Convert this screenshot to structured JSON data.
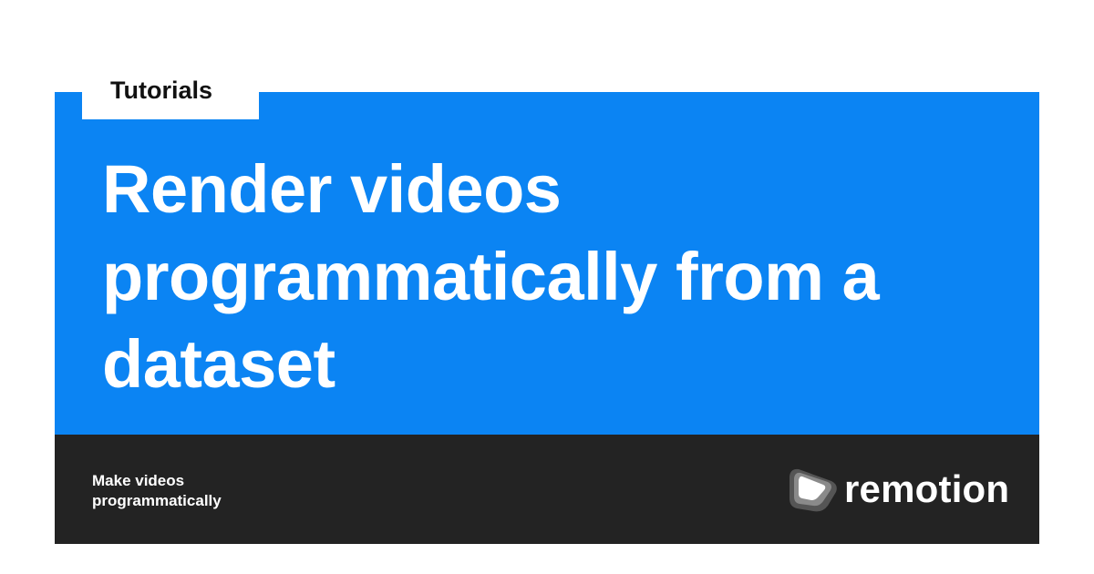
{
  "category": {
    "label": "Tutorials"
  },
  "headline": {
    "text": "Render videos programmatically from a dataset"
  },
  "footer": {
    "tagline_line1": "Make videos",
    "tagline_line2": "programmatically"
  },
  "brand": {
    "name": "remotion",
    "logo_icon": "remotion-play-logo-icon"
  },
  "colors": {
    "accent_blue": "#0b84f3",
    "footer_dark": "#232323",
    "text_light": "#ffffff",
    "text_dark": "#111111"
  }
}
